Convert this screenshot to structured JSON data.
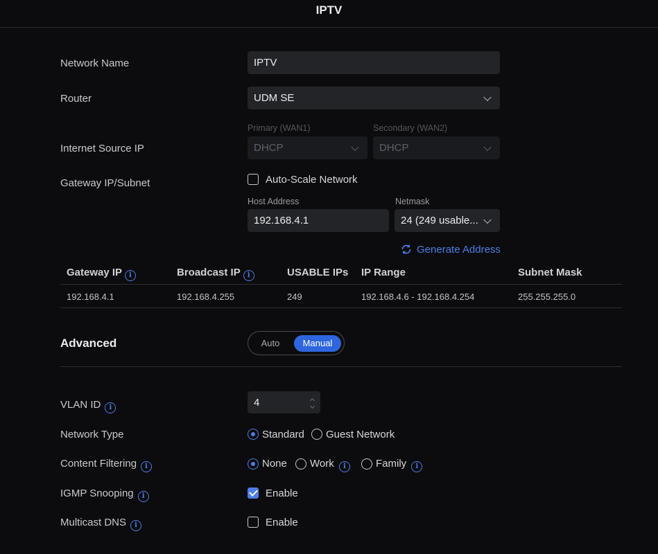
{
  "header": {
    "title": "IPTV"
  },
  "network_name": {
    "label": "Network Name",
    "value": "IPTV"
  },
  "router": {
    "label": "Router",
    "value": "UDM SE"
  },
  "internet_source": {
    "label": "Internet Source IP",
    "primary_label": "Primary (WAN1)",
    "primary_value": "DHCP",
    "secondary_label": "Secondary (WAN2)",
    "secondary_value": "DHCP"
  },
  "gateway": {
    "label": "Gateway IP/Subnet",
    "auto_scale_label": "Auto-Scale Network",
    "auto_scale_checked": false,
    "host_label": "Host Address",
    "host_value": "192.168.4.1",
    "netmask_label": "Netmask",
    "netmask_value": "24 (249 usable...",
    "generate_label": "Generate Address"
  },
  "subnet_table": {
    "headers": [
      "Gateway IP",
      "Broadcast IP",
      "USABLE IPs",
      "IP Range",
      "Subnet Mask"
    ],
    "row": [
      "192.168.4.1",
      "192.168.4.255",
      "249",
      "192.168.4.6 - 192.168.4.254",
      "255.255.255.0"
    ]
  },
  "advanced": {
    "title": "Advanced",
    "toggle": {
      "auto": "Auto",
      "manual": "Manual",
      "selected": "Manual"
    }
  },
  "vlan": {
    "label": "VLAN ID",
    "value": "4"
  },
  "network_type": {
    "label": "Network Type",
    "standard": "Standard",
    "guest": "Guest Network",
    "selected": "Standard"
  },
  "content_filtering": {
    "label": "Content Filtering",
    "none": "None",
    "work": "Work",
    "family": "Family",
    "selected": "None"
  },
  "igmp": {
    "label": "IGMP Snooping",
    "option": "Enable",
    "checked": true
  },
  "mdns": {
    "label": "Multicast DNS",
    "option": "Enable",
    "checked": false
  },
  "colors": {
    "accent": "#4d7ee8",
    "background": "#0c0c0e",
    "field": "#232428"
  }
}
